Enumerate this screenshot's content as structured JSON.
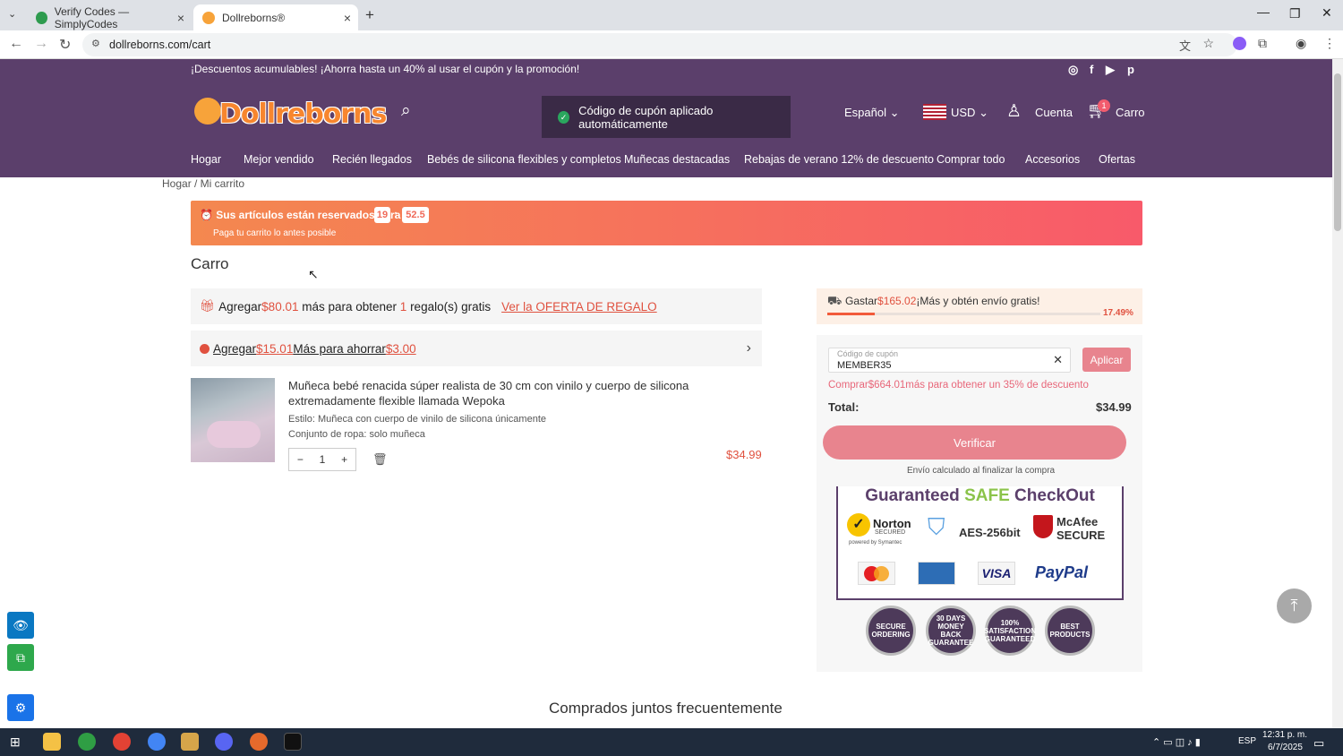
{
  "browser": {
    "tabs": [
      {
        "label": "Verify Codes — SimplyCodes",
        "active": false
      },
      {
        "label": "Dollreborns®",
        "active": true
      }
    ],
    "url": "dollreborns.com/cart"
  },
  "site": {
    "promo": "¡Descuentos acumulables! ¡Ahorra hasta un 40% al usar el cupón y la promoción!",
    "logo_text": "Dollreborns",
    "toast": "Código de cupón aplicado automáticamente",
    "language": "Español",
    "currency": "USD",
    "account": "Cuenta",
    "cart_label": "Carro",
    "cart_count": "1",
    "nav": [
      "Hogar",
      "Mejor vendido",
      "Recién llegados",
      "Bebés de silicona flexibles y completos",
      "Muñecas destacadas",
      "Rebajas de verano 12% de descuento",
      "Comprar todo",
      "Accesorios",
      "Ofertas"
    ]
  },
  "breadcrumb": "Hogar / Mi carrito",
  "reserve": {
    "text": "Sus artículos están reservados para",
    "minutes": "19",
    "sep": ":",
    "seconds": "52.5",
    "sub": "Paga tu carrito lo antes posible"
  },
  "cart": {
    "heading": "Carro",
    "gift": {
      "prefix": "Agregar",
      "amount": "$80.01",
      "middle": " más para obtener ",
      "count": "1",
      "suffix": " regalo(s) gratis",
      "link": "Ver la OFERTA DE REGALO"
    },
    "save": {
      "prefix": "Agregar",
      "amount": "$15.01",
      "middle": "Más para ahorrar",
      "saving": "$3.00"
    },
    "item": {
      "title": "Muñeca bebé renacida súper realista de 30 cm con vinilo y cuerpo de silicona extremadamente flexible llamada Wepoka",
      "style": "Estilo: Muñeca con cuerpo de vinilo de silicona únicamente",
      "outfit": "Conjunto de ropa: solo muñeca",
      "qty": "1",
      "price": "$34.99"
    }
  },
  "summary": {
    "ship_prefix": "Gastar",
    "ship_amount": "$165.02",
    "ship_suffix": "¡Más y obtén envío gratis!",
    "ship_percent": "17.49%",
    "ship_progress": 0.1749,
    "coupon_label": "Código de cupón",
    "coupon_value": "MEMBER35",
    "apply": "Aplicar",
    "coupon_hint": "Comprar$664.01más para obtener un 35% de descuento",
    "total_label": "Total:",
    "total_value": "$34.99",
    "verify": "Verificar",
    "shipping_note": "Envío calculado al finalizar la compra",
    "guarantee_a": "Guaranteed ",
    "guarantee_b": "SAFE",
    "guarantee_c": " CheckOut",
    "norton": "Norton",
    "norton_sub": "SECURED",
    "norton_by": "powered by Symantec",
    "aes": "AES-256bit",
    "mcafee": "McAfee",
    "mcafee_sub": "SECURE",
    "visa": "VISA",
    "paypal": "PayPal",
    "badges": [
      "SECURE ORDERING",
      "30 DAYS MONEY BACK GUARANTEE",
      "100% SATISFACTION GUARANTEED",
      "BEST PRODUCTS"
    ]
  },
  "related_heading": "Comprados juntos frecuentemente",
  "taskbar": {
    "lang": "ESP",
    "time": "12:31 p. m.",
    "date": "6/7/2025"
  }
}
